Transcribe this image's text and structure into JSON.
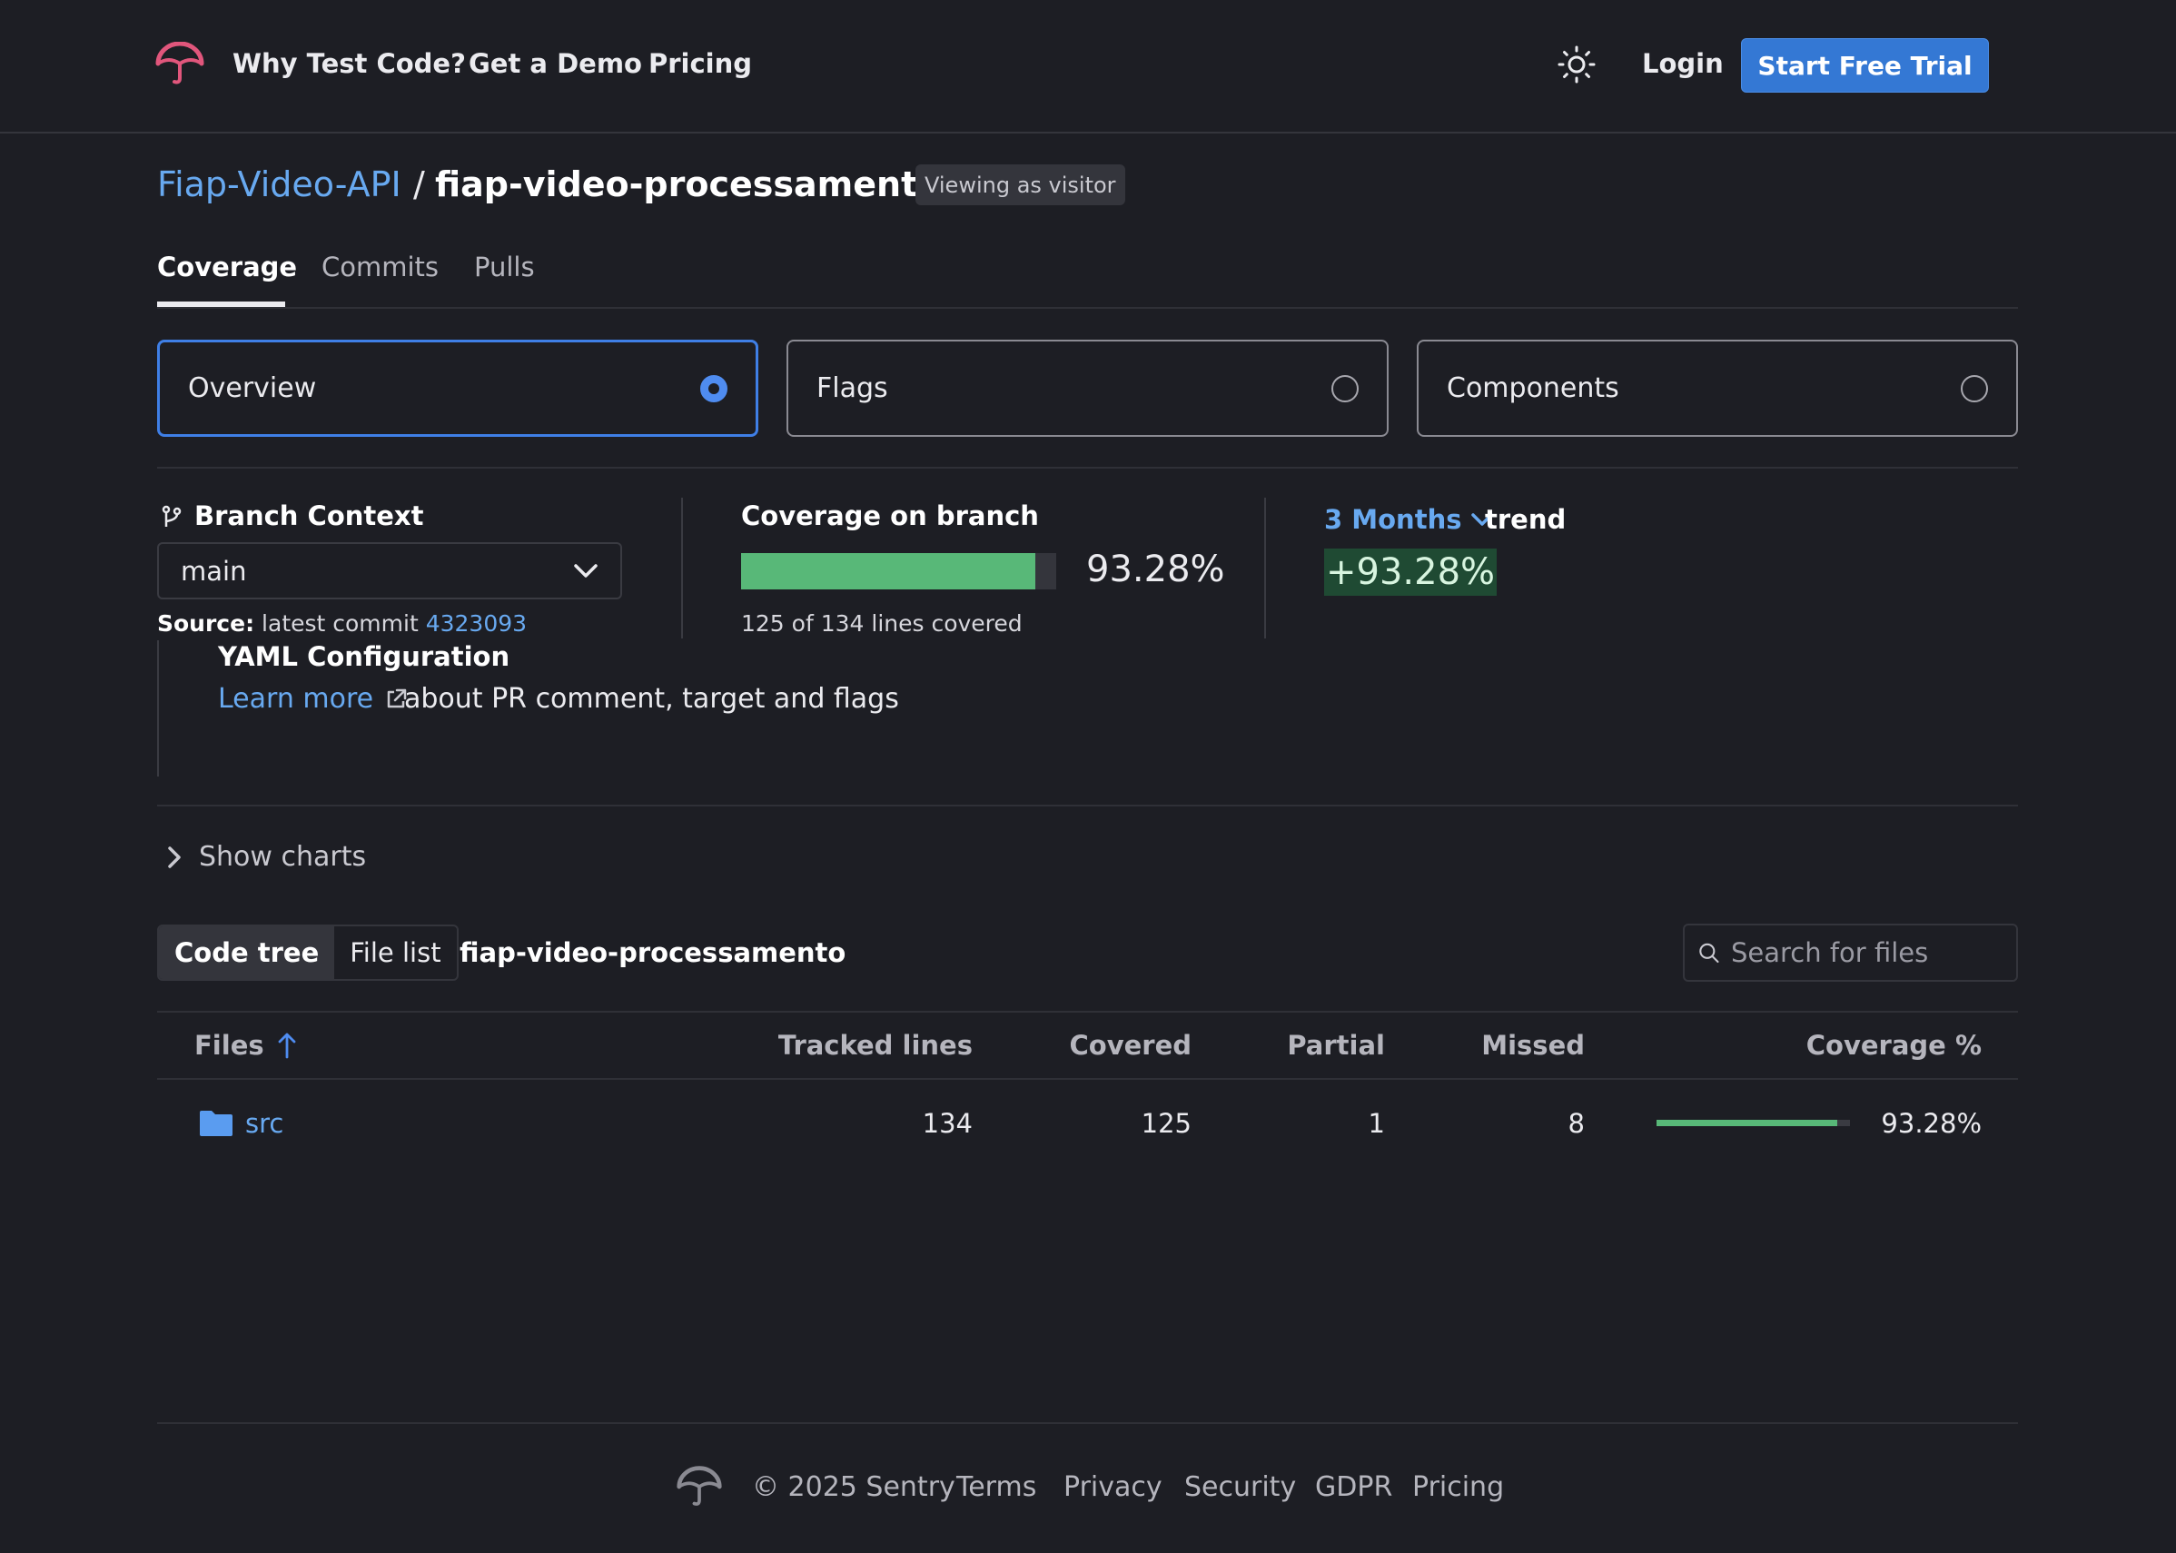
{
  "header": {
    "nav": [
      "Why Test Code?",
      "Get a Demo",
      "Pricing"
    ],
    "login": "Login",
    "trial": "Start Free Trial"
  },
  "breadcrumb": {
    "owner": "Fiap-Video-API",
    "separator": "/",
    "repo": "fiap-video-processamento",
    "badge": "Viewing as visitor"
  },
  "tabs": [
    "Coverage",
    "Commits",
    "Pulls"
  ],
  "options": [
    {
      "label": "Overview",
      "selected": true
    },
    {
      "label": "Flags",
      "selected": false
    },
    {
      "label": "Components",
      "selected": false
    }
  ],
  "branch": {
    "label": "Branch Context",
    "value": "main",
    "source_label": "Source:",
    "source_text": "latest commit",
    "commit": "4323093"
  },
  "coverage": {
    "label": "Coverage on branch",
    "percent": "93.28%",
    "fraction": 0.9328,
    "lines_text": "125 of 134 lines covered"
  },
  "trend": {
    "range": "3 Months",
    "label": "trend",
    "value": "+93.28%"
  },
  "yaml": {
    "title": "YAML Configuration",
    "link": "Learn more",
    "text": "about PR comment, target and flags"
  },
  "show_charts": "Show charts",
  "filetree": {
    "modes": [
      "Code tree",
      "File list"
    ],
    "path": "fiap-video-processamento",
    "search_placeholder": "Search for files",
    "columns": [
      "Files",
      "Tracked lines",
      "Covered",
      "Partial",
      "Missed",
      "Coverage %"
    ],
    "rows": [
      {
        "name": "src",
        "tracked": "134",
        "covered": "125",
        "partial": "1",
        "missed": "8",
        "coverage": "93.28%",
        "fraction": 0.9328
      }
    ]
  },
  "footer": {
    "copyright": "© 2025 Sentry",
    "links": [
      "Terms",
      "Privacy",
      "Security",
      "GDPR",
      "Pricing"
    ]
  },
  "colors": {
    "background": "#1d1e24",
    "accent": "#3478d4",
    "link": "#68a9f0",
    "success": "#58b878",
    "brand": "#e1567c"
  },
  "icons": [
    "umbrella-logo-icon",
    "sun-icon",
    "git-branch-icon",
    "chevron-down-icon",
    "external-link-icon",
    "chevron-right-icon",
    "search-icon",
    "arrow-up-icon",
    "folder-icon"
  ]
}
